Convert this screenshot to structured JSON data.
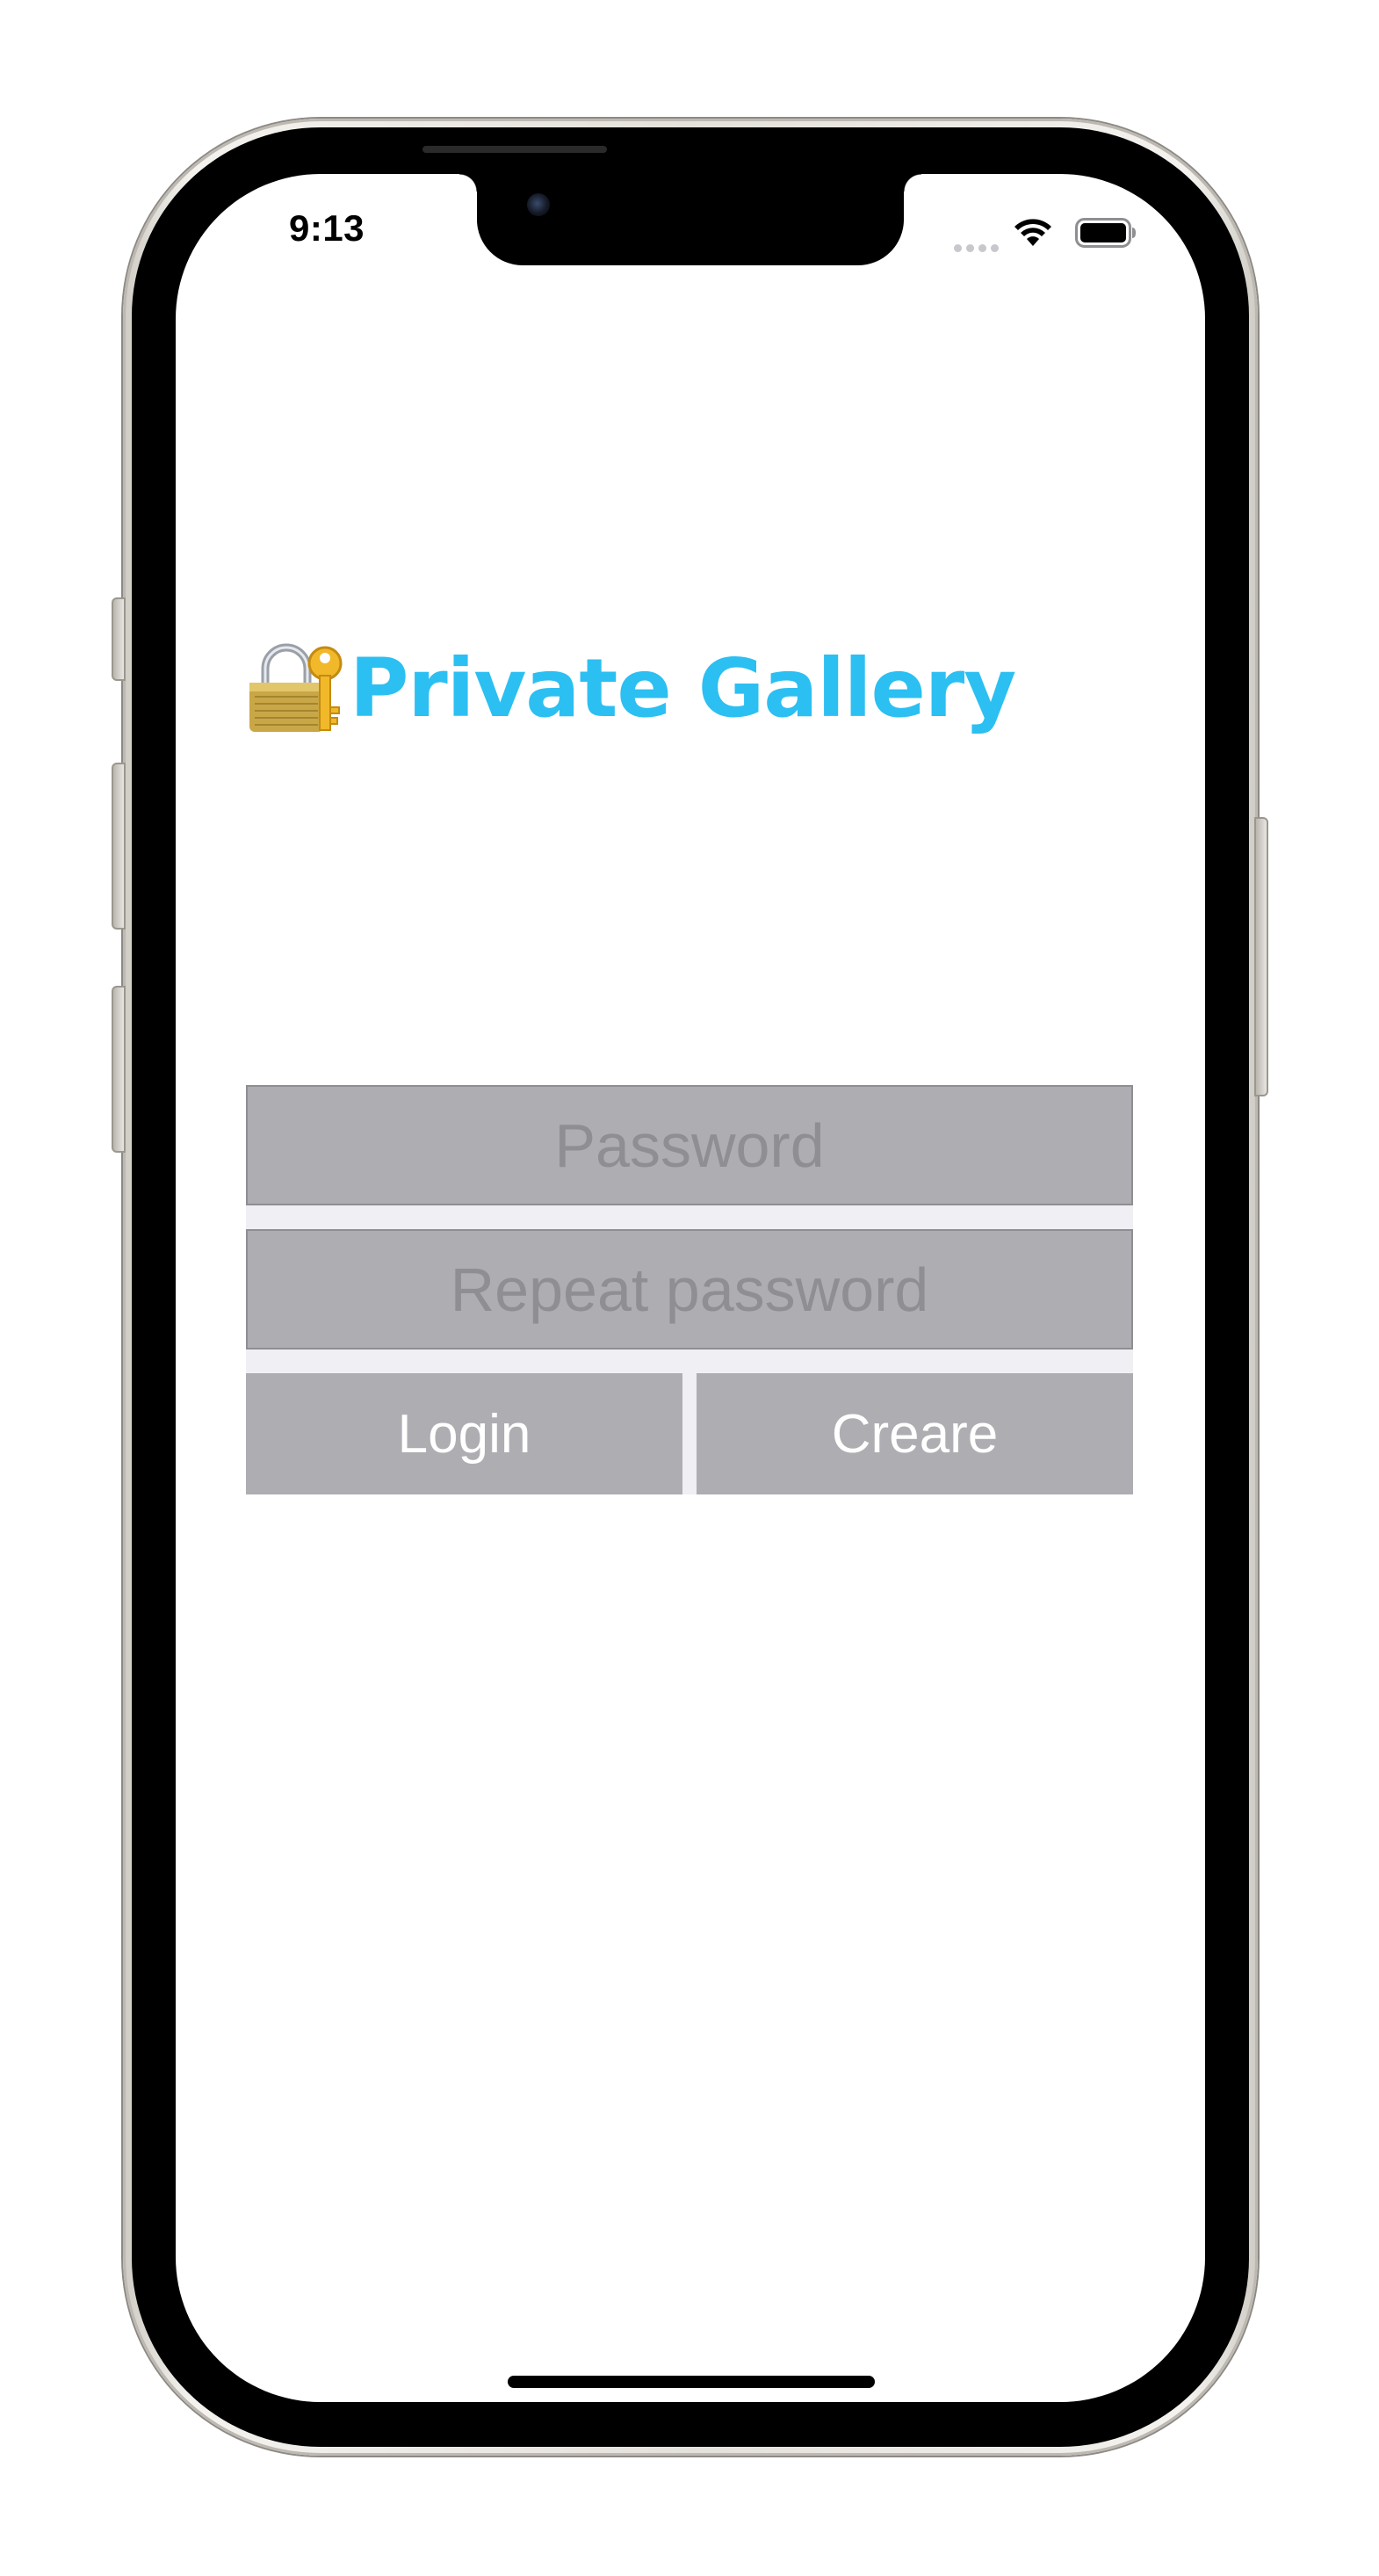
{
  "status_bar": {
    "time": "9:13"
  },
  "header": {
    "title": "Private Gallery",
    "icon": "lock-with-key-icon"
  },
  "form": {
    "password_placeholder": "Password",
    "password_value": "",
    "repeat_password_placeholder": "Repeat password",
    "repeat_password_value": "",
    "login_label": "Login",
    "create_label": "Creare"
  },
  "colors": {
    "title": "#2cbff2",
    "field_background": "#aeaeb2",
    "form_background": "#efeff4",
    "button_text": "#ffffff"
  }
}
